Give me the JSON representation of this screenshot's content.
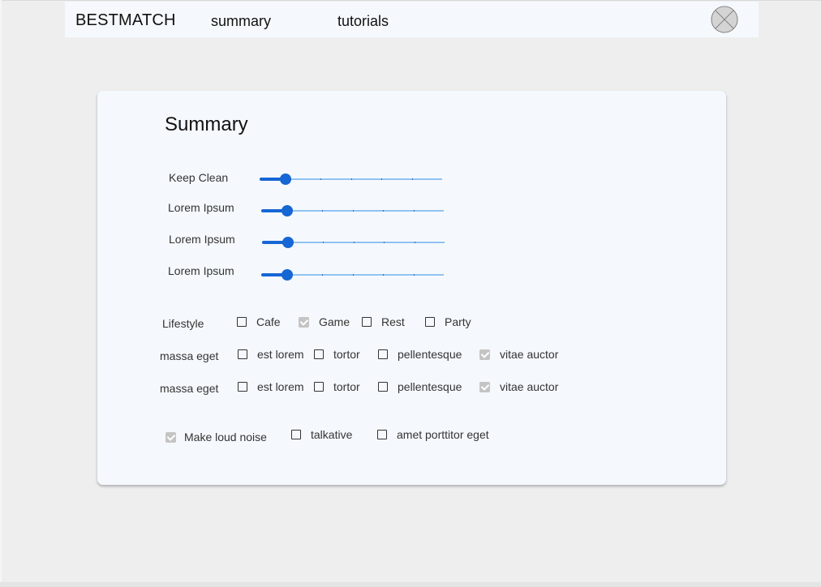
{
  "header": {
    "brand": "BESTMATCH",
    "nav": {
      "summary": "summary",
      "tutorials": "tutorials"
    }
  },
  "summary": {
    "title": "Summary",
    "sliders": [
      {
        "label": "Keep Clean",
        "value": 0.14
      },
      {
        "label": "Lorem Ipsum",
        "value": 0.14
      },
      {
        "label": "Lorem Ipsum",
        "value": 0.14
      },
      {
        "label": "Lorem Ipsum",
        "value": 0.14
      }
    ],
    "lifestyle": {
      "label": "Lifestyle",
      "options": [
        {
          "label": "Cafe",
          "checked": false
        },
        {
          "label": "Game",
          "checked": true
        },
        {
          "label": "Rest",
          "checked": false
        },
        {
          "label": "Party",
          "checked": false
        }
      ]
    },
    "rows": [
      {
        "label": "massa eget",
        "options": [
          {
            "label": "est lorem",
            "checked": false
          },
          {
            "label": "tortor",
            "checked": false
          },
          {
            "label": "pellentesque",
            "checked": false
          },
          {
            "label": "vitae auctor",
            "checked": true
          }
        ]
      },
      {
        "label": "massa eget",
        "options": [
          {
            "label": "est lorem",
            "checked": false
          },
          {
            "label": "tortor",
            "checked": false
          },
          {
            "label": "pellentesque",
            "checked": false
          },
          {
            "label": "vitae auctor",
            "checked": true
          }
        ]
      }
    ],
    "extras": [
      {
        "label": "Make loud noise",
        "checked": true
      },
      {
        "label": "talkative",
        "checked": false
      },
      {
        "label": "amet porttitor eget",
        "checked": false
      }
    ]
  },
  "colors": {
    "slider_accent": "#1666d4",
    "slider_track": "#90c2f3",
    "checked_box": "#c4c4c4",
    "card_bg": "#f5f9fd",
    "page_bg": "#eeeeee"
  },
  "icons": {
    "avatar": "close-circle-icon"
  }
}
